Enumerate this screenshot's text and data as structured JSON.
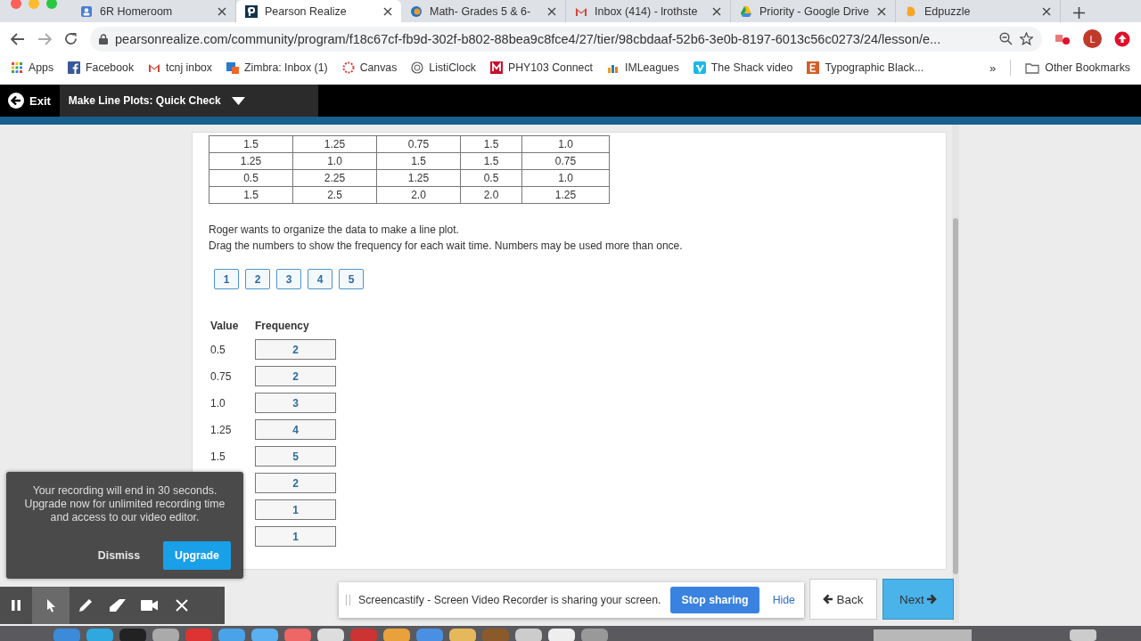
{
  "browser_tabs": [
    {
      "title": "6R Homeroom",
      "selected": false
    },
    {
      "title": "Pearson Realize",
      "selected": true
    },
    {
      "title": "Math- Grades 5 & 6-",
      "selected": false
    },
    {
      "title": "Inbox (414) - lrothste",
      "selected": false
    },
    {
      "title": "Priority - Google Drive",
      "selected": false
    },
    {
      "title": "Edpuzzle",
      "selected": false
    }
  ],
  "address_bar": {
    "url": "pearsonrealize.com/community/program/f18c67cf-fb9d-302f-b802-88bea9c8fce4/27/tier/98cbdaaf-52b6-3e0b-8197-6013c56c0273/24/lesson/e..."
  },
  "profile_initial": "L",
  "bookmarks": [
    {
      "label": "Apps"
    },
    {
      "label": "Facebook"
    },
    {
      "label": "tcnj inbox"
    },
    {
      "label": "Zimbra: Inbox (1)"
    },
    {
      "label": "Canvas"
    },
    {
      "label": "ListiClock"
    },
    {
      "label": "PHY103 Connect"
    },
    {
      "label": "IMLeagues"
    },
    {
      "label": "The Shack video"
    },
    {
      "label": "Typographic Black..."
    }
  ],
  "bookmarks_overflow": "»",
  "other_bookmarks": "Other Bookmarks",
  "app_header": {
    "exit": "Exit",
    "title": "Make Line Plots: Quick Check"
  },
  "wait_times_table": {
    "rows": [
      [
        "1.5",
        "1.25",
        "0.75",
        "1.5",
        "1.0"
      ],
      [
        "1.25",
        "1.0",
        "1.5",
        "1.5",
        "0.75"
      ],
      [
        "0.5",
        "2.25",
        "1.25",
        "0.5",
        "1.0"
      ],
      [
        "1.5",
        "2.5",
        "2.0",
        "2.0",
        "1.25"
      ]
    ]
  },
  "instructions": [
    "Roger wants to organize the data to make a line plot.",
    "Drag the numbers to show the frequency for each wait time. Numbers may be used more than once."
  ],
  "number_tiles": [
    "1",
    "2",
    "3",
    "4",
    "5"
  ],
  "frequency_table": {
    "columns": [
      "Value",
      "Frequency"
    ],
    "rows": [
      {
        "value": "0.5",
        "frequency": "2"
      },
      {
        "value": "0.75",
        "frequency": "2"
      },
      {
        "value": "1.0",
        "frequency": "3"
      },
      {
        "value": "1.25",
        "frequency": "4"
      },
      {
        "value": "1.5",
        "frequency": "5"
      },
      {
        "frequency": "2"
      },
      {
        "frequency": "1"
      },
      {
        "frequency": "1"
      }
    ]
  },
  "nav": {
    "back": "Back",
    "next": "Next"
  },
  "recording_popup": {
    "message": "Your recording will end in 30 seconds. Upgrade now for unlimited recording time and access to our video editor.",
    "dismiss": "Dismiss",
    "upgrade": "Upgrade"
  },
  "recorder_tools": [
    {
      "kind": "pause",
      "selected": false
    },
    {
      "kind": "pointer",
      "selected": true
    },
    {
      "kind": "pen",
      "selected": false
    },
    {
      "kind": "eraser",
      "selected": false
    },
    {
      "kind": "camera",
      "selected": false
    },
    {
      "kind": "close",
      "selected": false
    }
  ],
  "sharing_bar": {
    "message": "Screencastify - Screen Video Recorder is sharing your screen.",
    "stop": "Stop sharing",
    "hide": "Hide"
  }
}
